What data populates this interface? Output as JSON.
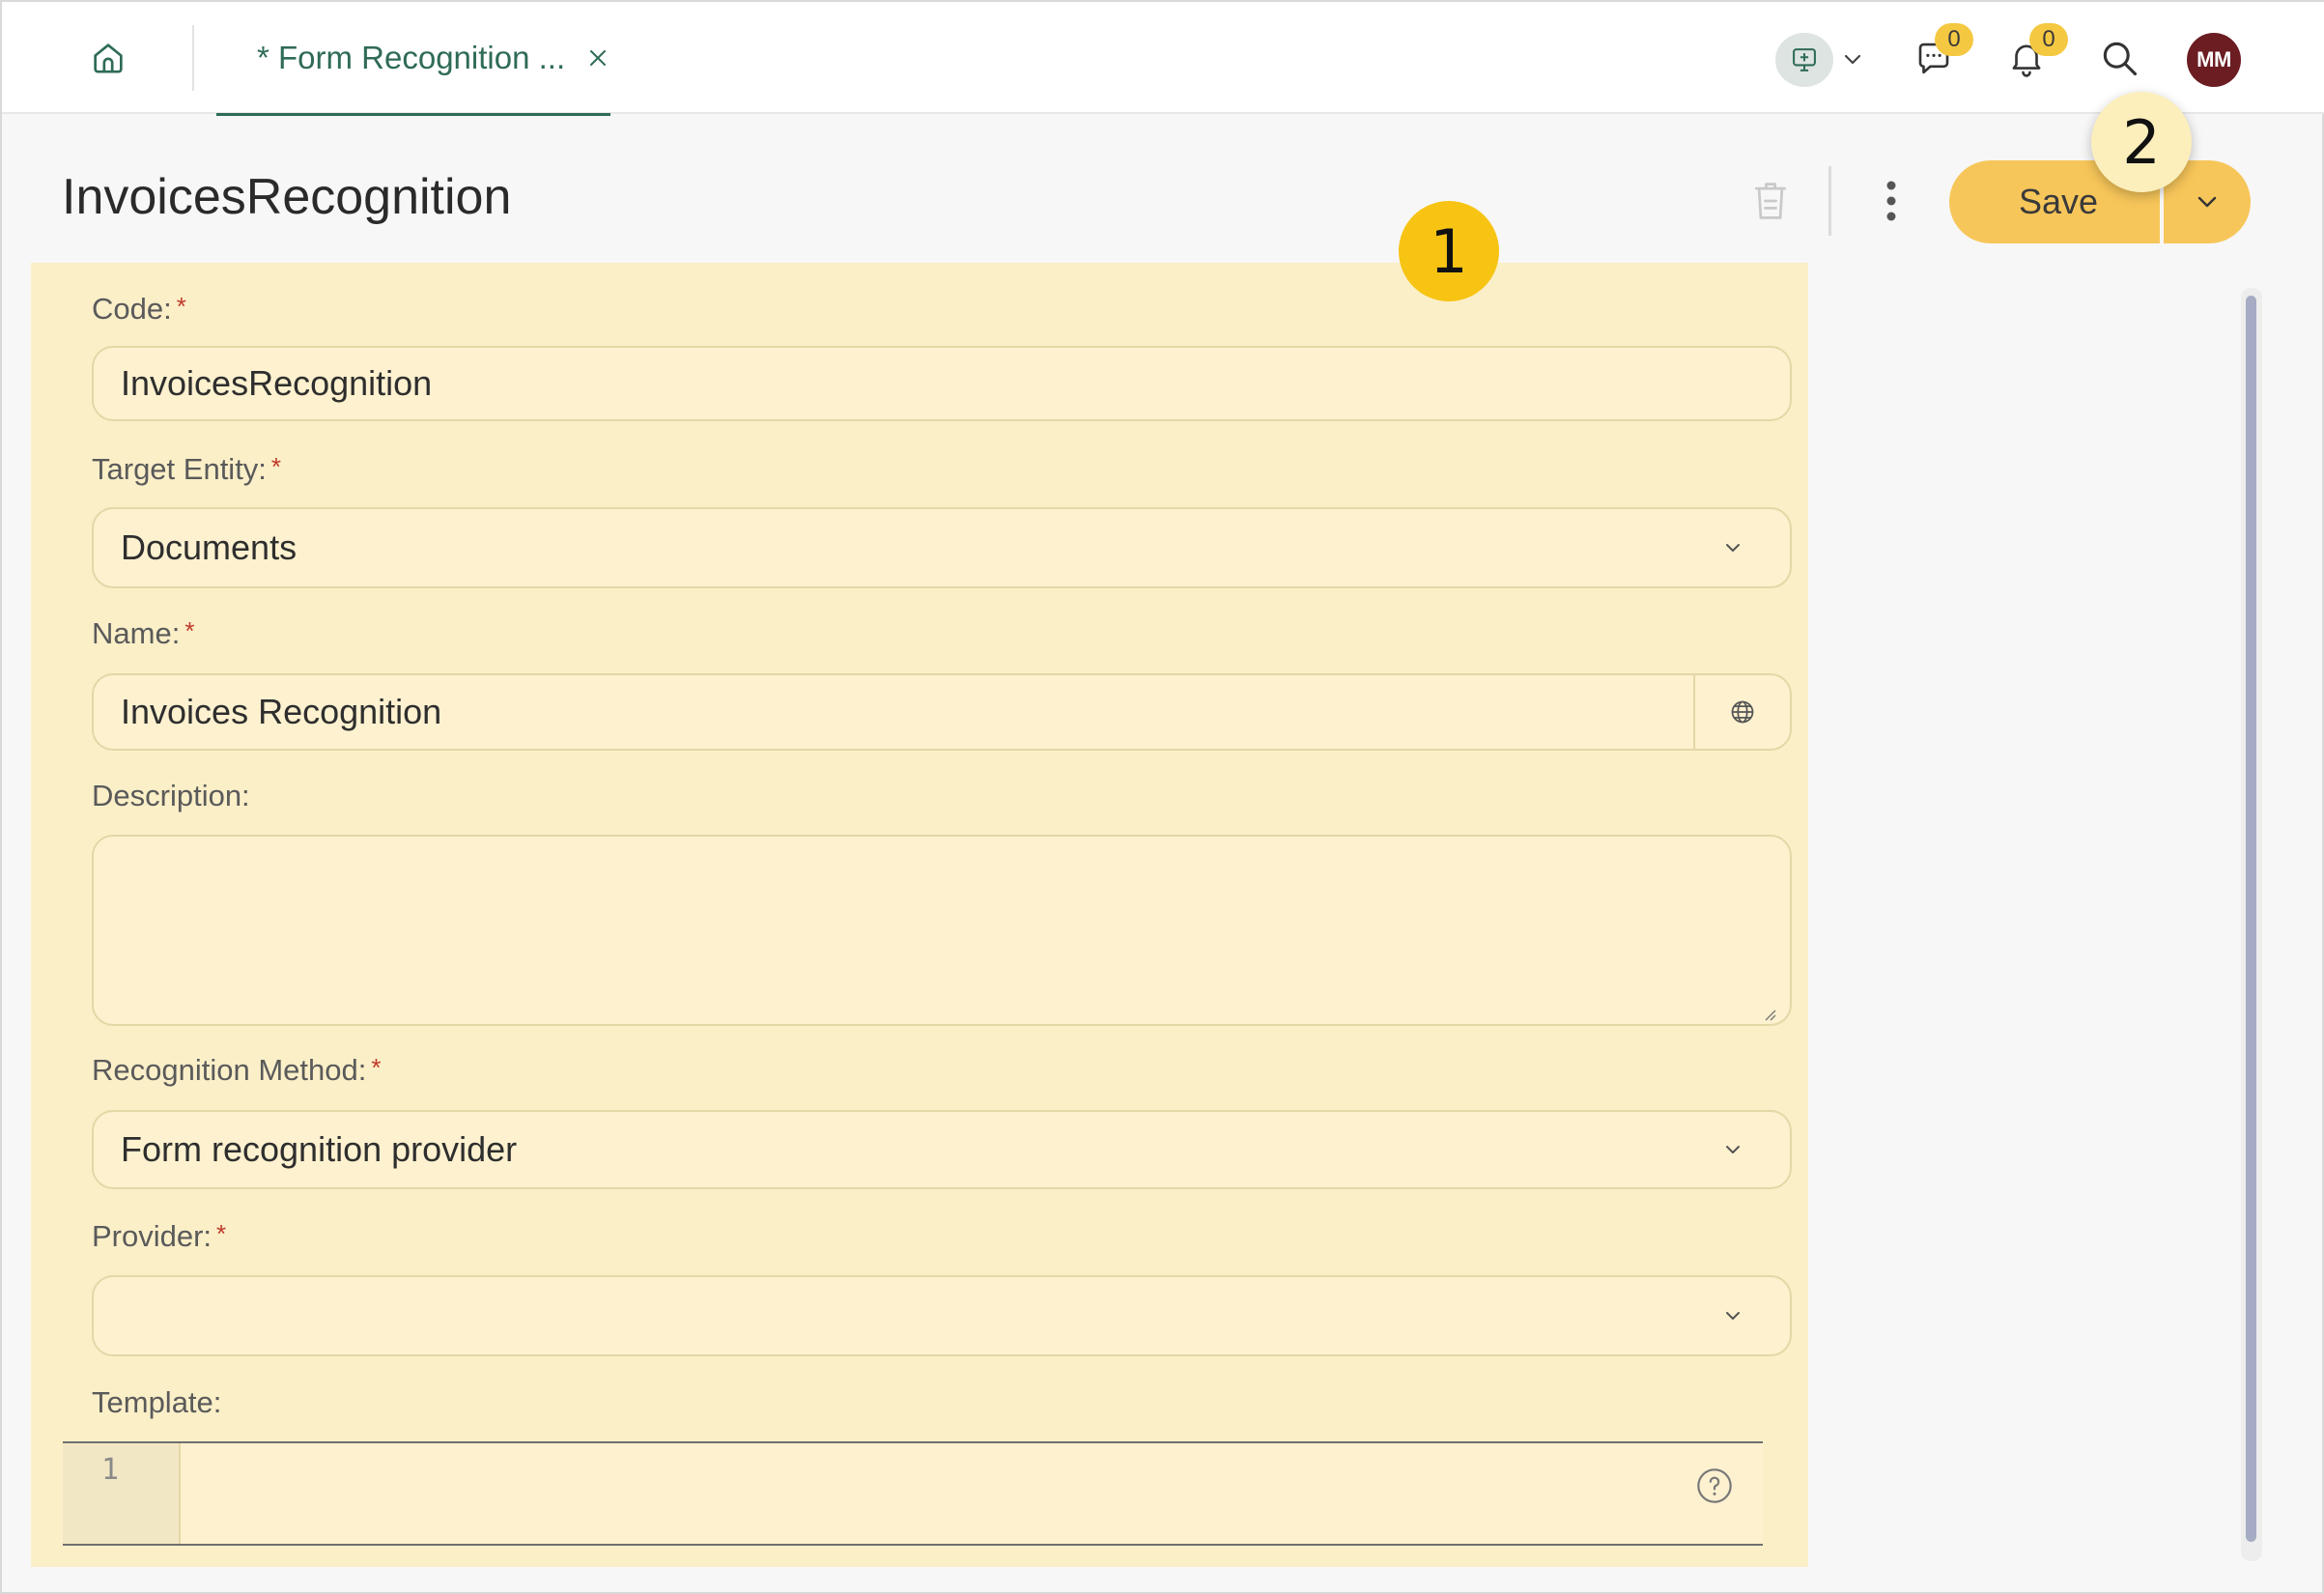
{
  "topbar": {
    "tab_label": "* Form Recognition ...",
    "chat_badge": "0",
    "notif_badge": "0",
    "avatar_initials": "MM"
  },
  "header": {
    "title": "InvoicesRecognition",
    "save_label": "Save"
  },
  "form": {
    "code": {
      "label": "Code:",
      "value": "InvoicesRecognition"
    },
    "target_entity": {
      "label": "Target Entity:",
      "value": "Documents"
    },
    "name": {
      "label": "Name:",
      "value": "Invoices Recognition"
    },
    "description": {
      "label": "Description:",
      "value": ""
    },
    "recognition_method": {
      "label": "Recognition Method:",
      "value": "Form recognition provider"
    },
    "provider": {
      "label": "Provider:",
      "value": ""
    },
    "template": {
      "label": "Template:",
      "line_number": "1"
    }
  },
  "required_mark": "*",
  "callouts": {
    "first": "1",
    "second": "2"
  },
  "colors": {
    "accent_green": "#2f6b57",
    "save_button": "#f7c65a",
    "panel_highlight": "#fbefc8",
    "badge": "#f5c842",
    "avatar": "#6b1d22",
    "callout_1": "#f7c414"
  },
  "icons": {
    "home": "home-icon",
    "close": "close-icon",
    "agent": "agent-icon",
    "chat": "chat-icon",
    "bell": "bell-icon",
    "search": "search-icon",
    "trash": "trash-icon",
    "kebab": "kebab-menu-icon",
    "chevron": "chevron-down-icon",
    "globe": "globe-icon",
    "help": "help-icon"
  }
}
